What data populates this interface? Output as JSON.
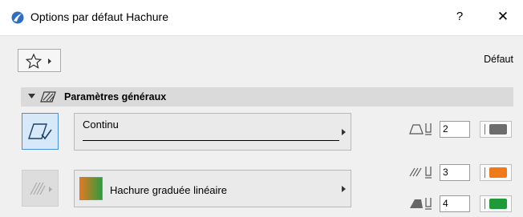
{
  "window": {
    "title": "Options par défaut Hachure",
    "help_label": "?",
    "close_label": "✕"
  },
  "toolbar": {
    "default_label": "Défaut"
  },
  "section": {
    "title": "Paramètres généraux"
  },
  "line": {
    "type_label": "Continu"
  },
  "pens": {
    "contour": {
      "value": "2",
      "color": "#6d6d6d"
    },
    "foreground": {
      "value": "3",
      "color": "#f07a1a"
    },
    "background": {
      "value": "4",
      "color": "#1f9a38"
    }
  },
  "fill": {
    "name": "Hachure graduée linéaire",
    "gradient_start": "#e07a22",
    "gradient_end": "#2e9b3d"
  }
}
